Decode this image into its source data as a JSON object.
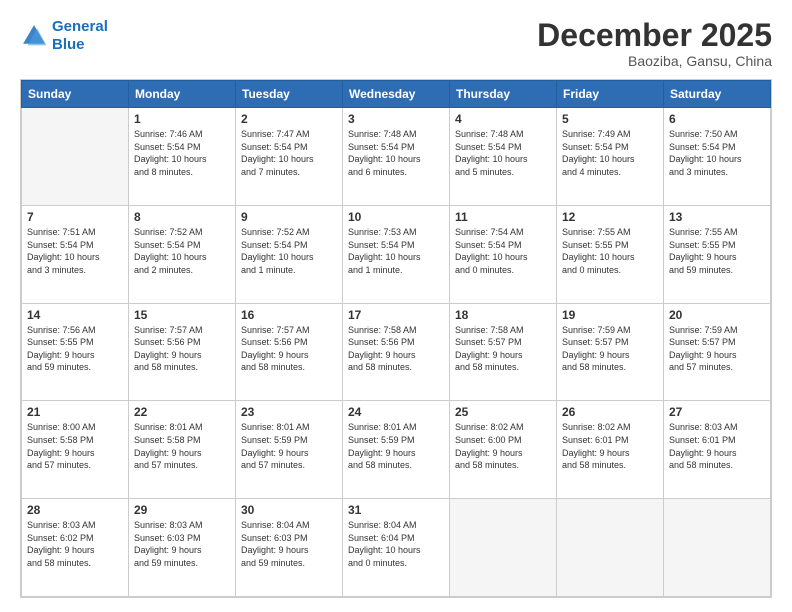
{
  "header": {
    "logo_line1": "General",
    "logo_line2": "Blue",
    "month": "December 2025",
    "location": "Baoziba, Gansu, China"
  },
  "weekdays": [
    "Sunday",
    "Monday",
    "Tuesday",
    "Wednesday",
    "Thursday",
    "Friday",
    "Saturday"
  ],
  "weeks": [
    [
      {
        "day": "",
        "info": ""
      },
      {
        "day": "1",
        "info": "Sunrise: 7:46 AM\nSunset: 5:54 PM\nDaylight: 10 hours\nand 8 minutes."
      },
      {
        "day": "2",
        "info": "Sunrise: 7:47 AM\nSunset: 5:54 PM\nDaylight: 10 hours\nand 7 minutes."
      },
      {
        "day": "3",
        "info": "Sunrise: 7:48 AM\nSunset: 5:54 PM\nDaylight: 10 hours\nand 6 minutes."
      },
      {
        "day": "4",
        "info": "Sunrise: 7:48 AM\nSunset: 5:54 PM\nDaylight: 10 hours\nand 5 minutes."
      },
      {
        "day": "5",
        "info": "Sunrise: 7:49 AM\nSunset: 5:54 PM\nDaylight: 10 hours\nand 4 minutes."
      },
      {
        "day": "6",
        "info": "Sunrise: 7:50 AM\nSunset: 5:54 PM\nDaylight: 10 hours\nand 3 minutes."
      }
    ],
    [
      {
        "day": "7",
        "info": "Sunrise: 7:51 AM\nSunset: 5:54 PM\nDaylight: 10 hours\nand 3 minutes."
      },
      {
        "day": "8",
        "info": "Sunrise: 7:52 AM\nSunset: 5:54 PM\nDaylight: 10 hours\nand 2 minutes."
      },
      {
        "day": "9",
        "info": "Sunrise: 7:52 AM\nSunset: 5:54 PM\nDaylight: 10 hours\nand 1 minute."
      },
      {
        "day": "10",
        "info": "Sunrise: 7:53 AM\nSunset: 5:54 PM\nDaylight: 10 hours\nand 1 minute."
      },
      {
        "day": "11",
        "info": "Sunrise: 7:54 AM\nSunset: 5:54 PM\nDaylight: 10 hours\nand 0 minutes."
      },
      {
        "day": "12",
        "info": "Sunrise: 7:55 AM\nSunset: 5:55 PM\nDaylight: 10 hours\nand 0 minutes."
      },
      {
        "day": "13",
        "info": "Sunrise: 7:55 AM\nSunset: 5:55 PM\nDaylight: 9 hours\nand 59 minutes."
      }
    ],
    [
      {
        "day": "14",
        "info": "Sunrise: 7:56 AM\nSunset: 5:55 PM\nDaylight: 9 hours\nand 59 minutes."
      },
      {
        "day": "15",
        "info": "Sunrise: 7:57 AM\nSunset: 5:56 PM\nDaylight: 9 hours\nand 58 minutes."
      },
      {
        "day": "16",
        "info": "Sunrise: 7:57 AM\nSunset: 5:56 PM\nDaylight: 9 hours\nand 58 minutes."
      },
      {
        "day": "17",
        "info": "Sunrise: 7:58 AM\nSunset: 5:56 PM\nDaylight: 9 hours\nand 58 minutes."
      },
      {
        "day": "18",
        "info": "Sunrise: 7:58 AM\nSunset: 5:57 PM\nDaylight: 9 hours\nand 58 minutes."
      },
      {
        "day": "19",
        "info": "Sunrise: 7:59 AM\nSunset: 5:57 PM\nDaylight: 9 hours\nand 58 minutes."
      },
      {
        "day": "20",
        "info": "Sunrise: 7:59 AM\nSunset: 5:57 PM\nDaylight: 9 hours\nand 57 minutes."
      }
    ],
    [
      {
        "day": "21",
        "info": "Sunrise: 8:00 AM\nSunset: 5:58 PM\nDaylight: 9 hours\nand 57 minutes."
      },
      {
        "day": "22",
        "info": "Sunrise: 8:01 AM\nSunset: 5:58 PM\nDaylight: 9 hours\nand 57 minutes."
      },
      {
        "day": "23",
        "info": "Sunrise: 8:01 AM\nSunset: 5:59 PM\nDaylight: 9 hours\nand 57 minutes."
      },
      {
        "day": "24",
        "info": "Sunrise: 8:01 AM\nSunset: 5:59 PM\nDaylight: 9 hours\nand 58 minutes."
      },
      {
        "day": "25",
        "info": "Sunrise: 8:02 AM\nSunset: 6:00 PM\nDaylight: 9 hours\nand 58 minutes."
      },
      {
        "day": "26",
        "info": "Sunrise: 8:02 AM\nSunset: 6:01 PM\nDaylight: 9 hours\nand 58 minutes."
      },
      {
        "day": "27",
        "info": "Sunrise: 8:03 AM\nSunset: 6:01 PM\nDaylight: 9 hours\nand 58 minutes."
      }
    ],
    [
      {
        "day": "28",
        "info": "Sunrise: 8:03 AM\nSunset: 6:02 PM\nDaylight: 9 hours\nand 58 minutes."
      },
      {
        "day": "29",
        "info": "Sunrise: 8:03 AM\nSunset: 6:03 PM\nDaylight: 9 hours\nand 59 minutes."
      },
      {
        "day": "30",
        "info": "Sunrise: 8:04 AM\nSunset: 6:03 PM\nDaylight: 9 hours\nand 59 minutes."
      },
      {
        "day": "31",
        "info": "Sunrise: 8:04 AM\nSunset: 6:04 PM\nDaylight: 10 hours\nand 0 minutes."
      },
      {
        "day": "",
        "info": ""
      },
      {
        "day": "",
        "info": ""
      },
      {
        "day": "",
        "info": ""
      }
    ]
  ]
}
